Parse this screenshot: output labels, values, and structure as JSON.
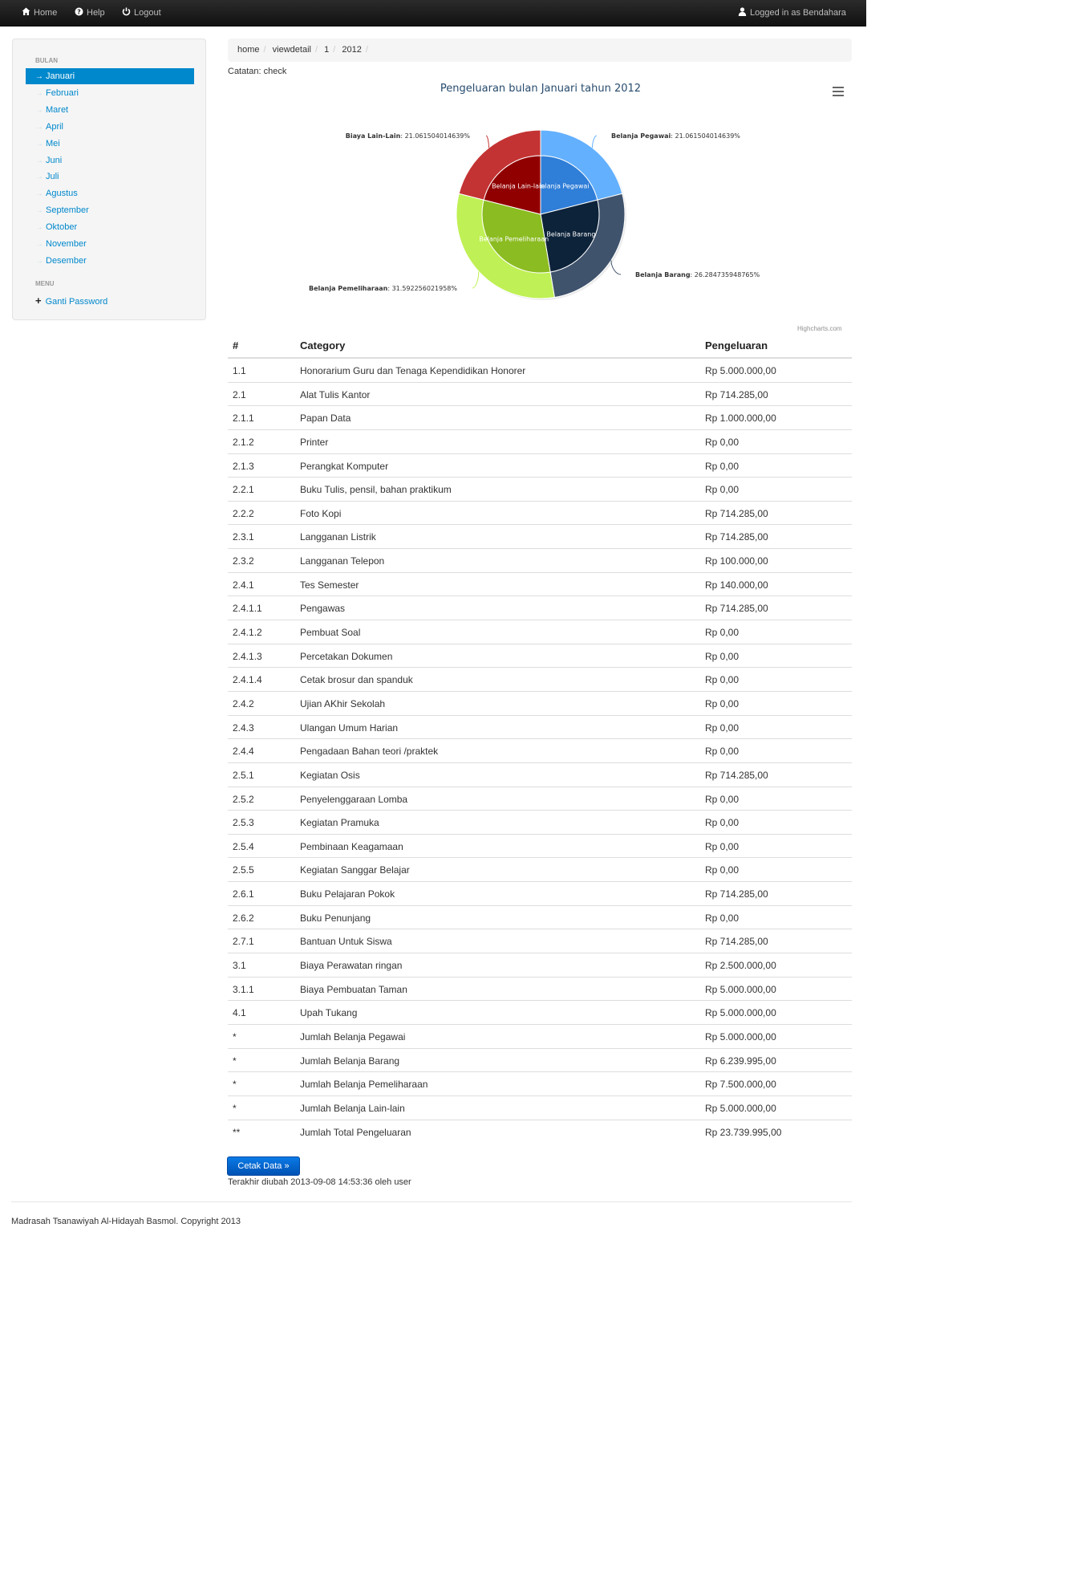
{
  "navbar": {
    "home": "Home",
    "help": "Help",
    "logout": "Logout",
    "user": "Logged in as Bendahara"
  },
  "sidebar": {
    "months_header": "BULAN",
    "months": [
      "Januari",
      "Februari",
      "Maret",
      "April",
      "Mei",
      "Juni",
      "Juli",
      "Agustus",
      "September",
      "Oktober",
      "November",
      "Desember"
    ],
    "active_month": "Januari",
    "menu_header": "MENU",
    "menu_item": "Ganti Password"
  },
  "breadcrumb": [
    "home",
    "viewdetail",
    "1",
    "2012"
  ],
  "note": "Catatan: check",
  "chart_data": {
    "type": "pie",
    "title": "Pengeluaran bulan Januari tahun 2012",
    "credit": "Highcharts.com",
    "series": [
      {
        "name": "Belanja Pegawai",
        "value": 21.061504014639,
        "label": "21.061504014639%",
        "color": "#2f7ed8",
        "outer_color": "#63b0ff"
      },
      {
        "name": "Belanja Barang",
        "value": 26.284735948765,
        "label": "26.284735948765%",
        "color": "#0d233a",
        "outer_color": "#40536d"
      },
      {
        "name": "Belanja Pemeliharaan",
        "value": 31.592256021958,
        "label": "31.592256021958%",
        "color": "#8bbc21",
        "outer_color": "#bff055"
      },
      {
        "name": "Belanja Lain-lain",
        "value": 21.061504014639,
        "label": "21.061504014639%",
        "color": "#910000",
        "outer_color": "#c43333"
      }
    ],
    "outer_labels": [
      "Belanja Pegawai",
      "Belanja Barang",
      "Belanja Pemeliharaan",
      "Biaya Lain-Lain"
    ]
  },
  "table": {
    "headers": [
      "#",
      "Category",
      "Pengeluaran"
    ],
    "rows": [
      [
        "1.1",
        "Honorarium Guru dan Tenaga Kependidikan Honorer",
        "Rp 5.000.000,00"
      ],
      [
        "2.1",
        "Alat Tulis Kantor",
        "Rp 714.285,00"
      ],
      [
        "2.1.1",
        "Papan Data",
        "Rp 1.000.000,00"
      ],
      [
        "2.1.2",
        "Printer",
        "Rp 0,00"
      ],
      [
        "2.1.3",
        "Perangkat Komputer",
        "Rp 0,00"
      ],
      [
        "2.2.1",
        "Buku Tulis, pensil, bahan praktikum",
        "Rp 0,00"
      ],
      [
        "2.2.2",
        "Foto Kopi",
        "Rp 714.285,00"
      ],
      [
        "2.3.1",
        "Langganan Listrik",
        "Rp 714.285,00"
      ],
      [
        "2.3.2",
        "Langganan Telepon",
        "Rp 100.000,00"
      ],
      [
        "2.4.1",
        "Tes Semester",
        "Rp 140.000,00"
      ],
      [
        "2.4.1.1",
        "Pengawas",
        "Rp 714.285,00"
      ],
      [
        "2.4.1.2",
        "Pembuat Soal",
        "Rp 0,00"
      ],
      [
        "2.4.1.3",
        "Percetakan Dokumen",
        "Rp 0,00"
      ],
      [
        "2.4.1.4",
        "Cetak brosur dan spanduk",
        "Rp 0,00"
      ],
      [
        "2.4.2",
        "Ujian AKhir Sekolah",
        "Rp 0,00"
      ],
      [
        "2.4.3",
        "Ulangan Umum Harian",
        "Rp 0,00"
      ],
      [
        "2.4.4",
        "Pengadaan Bahan teori /praktek",
        "Rp 0,00"
      ],
      [
        "2.5.1",
        "Kegiatan Osis",
        "Rp 714.285,00"
      ],
      [
        "2.5.2",
        "Penyelenggaraan Lomba",
        "Rp 0,00"
      ],
      [
        "2.5.3",
        "Kegiatan Pramuka",
        "Rp 0,00"
      ],
      [
        "2.5.4",
        "Pembinaan Keagamaan",
        "Rp 0,00"
      ],
      [
        "2.5.5",
        "Kegiatan Sanggar Belajar",
        "Rp 0,00"
      ],
      [
        "2.6.1",
        "Buku Pelajaran Pokok",
        "Rp 714.285,00"
      ],
      [
        "2.6.2",
        "Buku Penunjang",
        "Rp 0,00"
      ],
      [
        "2.7.1",
        "Bantuan Untuk Siswa",
        "Rp 714.285,00"
      ],
      [
        "3.1",
        "Biaya Perawatan ringan",
        "Rp 2.500.000,00"
      ],
      [
        "3.1.1",
        "Biaya Pembuatan Taman",
        "Rp 5.000.000,00"
      ],
      [
        "4.1",
        "Upah Tukang",
        "Rp 5.000.000,00"
      ],
      [
        "*",
        "Jumlah Belanja Pegawai",
        "Rp 5.000.000,00"
      ],
      [
        "*",
        "Jumlah Belanja Barang",
        "Rp 6.239.995,00"
      ],
      [
        "*",
        "Jumlah Belanja Pemeliharaan",
        "Rp 7.500.000,00"
      ],
      [
        "*",
        "Jumlah Belanja Lain-lain",
        "Rp 5.000.000,00"
      ],
      [
        "**",
        "Jumlah Total Pengeluaran",
        "Rp 23.739.995,00"
      ]
    ]
  },
  "print_button": "Cetak Data »",
  "updated": "Terakhir diubah 2013-09-08 14:53:36 oleh user",
  "footer": "Madrasah Tsanawiyah Al-Hidayah Basmol. Copyright 2013"
}
